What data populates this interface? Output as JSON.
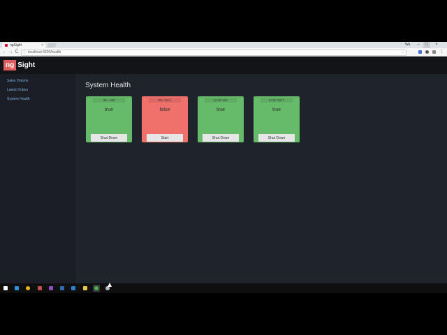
{
  "browser": {
    "tab_title": "ngSight",
    "tab_close": "×",
    "url": "localhost:4200/health",
    "info_icon": "ⓘ",
    "star_icon": "☆",
    "user_chip": "Wa",
    "win_min": "–",
    "win_max": "□",
    "win_close": "×",
    "back": "←",
    "forward": "→",
    "reload": "C",
    "menu": "⋮"
  },
  "app": {
    "brand_ng": "ng",
    "brand_sight": "Sight"
  },
  "sidebar": {
    "items": [
      {
        "label": "Sales Volume"
      },
      {
        "label": "Latest Orders"
      },
      {
        "label": "System Health"
      }
    ]
  },
  "main": {
    "title": "System Health",
    "servers": [
      {
        "name": "dev-web",
        "status": "true",
        "action": "Shut Down",
        "color": "#66bb6a"
      },
      {
        "name": "dev-mail",
        "status": "false",
        "action": "Start",
        "color": "#f0706b"
      },
      {
        "name": "prod-web",
        "status": "true",
        "action": "Shut Down",
        "color": "#66bb6a"
      },
      {
        "name": "prod-mail",
        "status": "true",
        "action": "Shut Down",
        "color": "#66bb6a"
      }
    ]
  },
  "taskbar": {
    "icons": [
      "windows-start",
      "store",
      "chrome",
      "visual-studio",
      "premiere",
      "photoshop",
      "file-explorer",
      "notepad-plus",
      "chrome-active",
      "obs"
    ]
  },
  "colors": {
    "accent": "#e05d5d",
    "nav_link": "#7faee0",
    "ok": "#66bb6a",
    "error": "#f0706b"
  }
}
